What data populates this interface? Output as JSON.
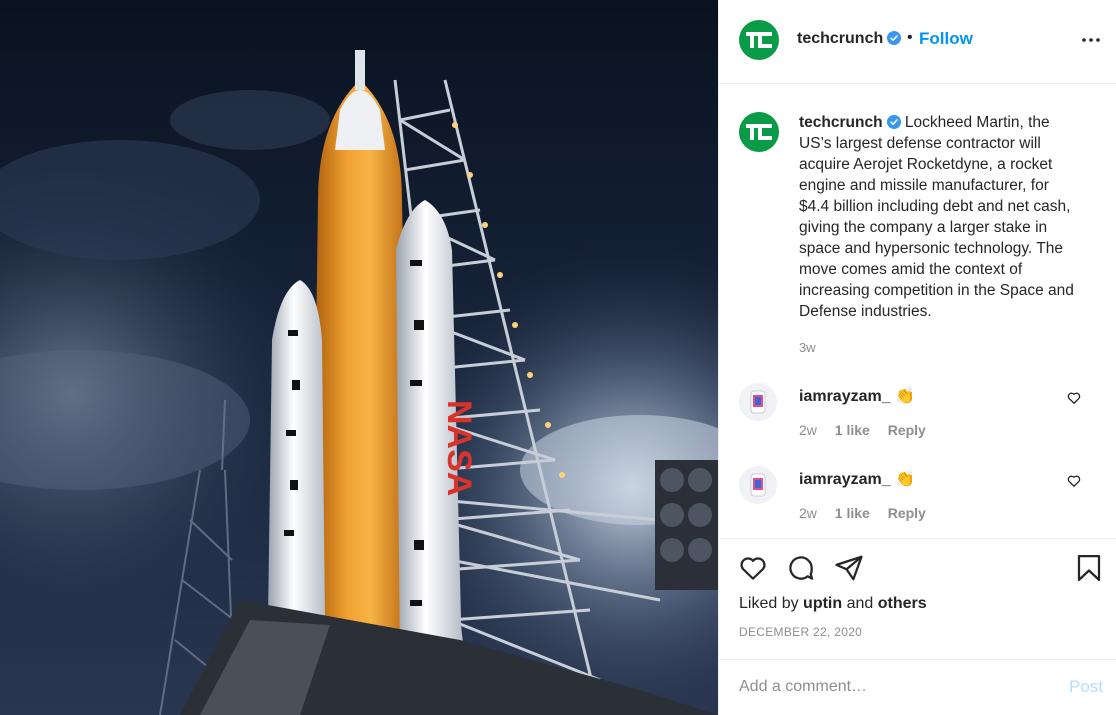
{
  "post": {
    "username": "techcrunch",
    "follow_label": "Follow",
    "separator": "•",
    "caption": "Lockheed Martin, the US’s largest defense contractor will acquire Aerojet Rocketdyne, a rocket engine and missile manufacturer, for $4.4 billion including debt and net cash, giving the company a larger stake in space and hypersonic technology. The move comes amid the context of increasing competition in the Space and Defense industries.",
    "caption_age": "3w",
    "image_text": "NASA"
  },
  "comments": [
    {
      "username": "iamrayzam_",
      "emoji": "👏",
      "age": "2w",
      "likes": "1 like",
      "reply": "Reply"
    },
    {
      "username": "iamrayzam_",
      "emoji": "👏",
      "age": "2w",
      "likes": "1 like",
      "reply": "Reply"
    }
  ],
  "engagement": {
    "liked_prefix": "Liked by",
    "liked_user": "uptin",
    "liked_and": "and",
    "liked_others": "others",
    "date": "DECEMBER 22, 2020"
  },
  "comment_box": {
    "placeholder": "Add a comment…",
    "post_label": "Post"
  },
  "colors": {
    "brand_green": "#0a9b48",
    "link_blue": "#0095f6",
    "post_disabled": "#b2dffc",
    "rocket_orange": "#e8901c"
  },
  "icons": [
    "verified-badge-icon",
    "more-options-icon",
    "heart-icon",
    "comment-icon",
    "share-icon",
    "bookmark-icon"
  ]
}
